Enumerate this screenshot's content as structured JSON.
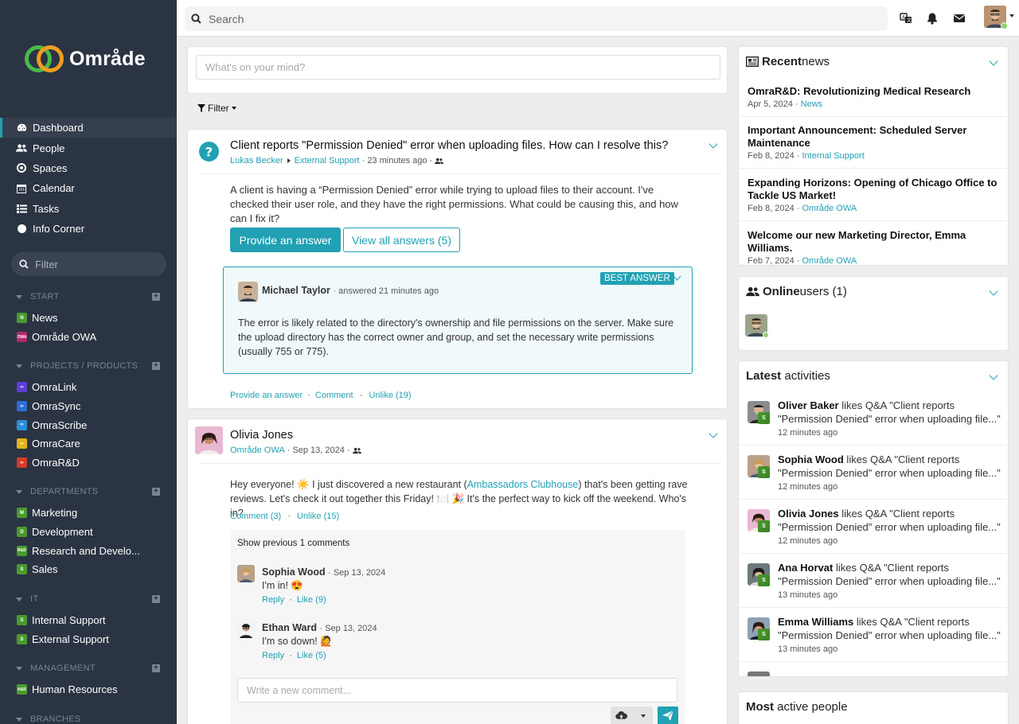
{
  "brand": {
    "name": "Område"
  },
  "nav": [
    {
      "label": "Dashboard",
      "icon": "dashboard-icon",
      "active": true
    },
    {
      "label": "People",
      "icon": "people-icon"
    },
    {
      "label": "Spaces",
      "icon": "spaces-icon"
    },
    {
      "label": "Calendar",
      "icon": "calendar-icon"
    },
    {
      "label": "Tasks",
      "icon": "tasks-icon"
    },
    {
      "label": "Info Corner",
      "icon": "info-corner-icon"
    }
  ],
  "sidebar_filter": {
    "placeholder": "Filter"
  },
  "sections": [
    {
      "title": "START",
      "items": [
        {
          "label": "News",
          "badge": "N",
          "color": "#4a9b2f"
        },
        {
          "label": "Område OWA",
          "badge": "OWA",
          "color": "#b0286a"
        }
      ]
    },
    {
      "title": "PROJECTS / PRODUCTS",
      "items": [
        {
          "label": "OmraLink",
          "badge": "",
          "color": "#5b3fd6"
        },
        {
          "label": "OmraSync",
          "badge": "",
          "color": "#2a6fd8"
        },
        {
          "label": "OmraScribe",
          "badge": "",
          "color": "#2a8fd8"
        },
        {
          "label": "OmraCare",
          "badge": "",
          "color": "#e0b41a"
        },
        {
          "label": "OmraR&D",
          "badge": "",
          "color": "#d63a2a"
        }
      ]
    },
    {
      "title": "DEPARTMENTS",
      "items": [
        {
          "label": "Marketing",
          "badge": "M",
          "color": "#4a9b2f"
        },
        {
          "label": "Development",
          "badge": "D",
          "color": "#4a9b2f"
        },
        {
          "label": "Research and Develo...",
          "badge": "R&D",
          "color": "#4a9b2f"
        },
        {
          "label": "Sales",
          "badge": "S",
          "color": "#4a9b2f"
        }
      ]
    },
    {
      "title": "IT",
      "items": [
        {
          "label": "Internal Support",
          "badge": "S",
          "color": "#4a9b2f"
        },
        {
          "label": "External Support",
          "badge": "S",
          "color": "#4a9b2f"
        }
      ]
    },
    {
      "title": "MANAGEMENT",
      "items": [
        {
          "label": "Human Resources",
          "badge": "H&R",
          "color": "#4a9b2f"
        }
      ]
    },
    {
      "title": "BRANCHES",
      "items": []
    }
  ],
  "topbar": {
    "search_placeholder": "Search"
  },
  "composer": {
    "placeholder": "What's on your mind?"
  },
  "feed_filter": {
    "label": "Filter"
  },
  "post1": {
    "title": "Client reports \"Permission Denied\" error when uploading files. How can I resolve this?",
    "author": "Lukas Becker",
    "space": "External Support",
    "time": "· 23 minutes ago ·",
    "body": "A client is having a “Permission Denied” error while trying to upload files to their account. I've checked their user role, and they have the right permissions. What could be causing this, and how can I fix it?",
    "btn_answer": "Provide an answer",
    "btn_view": "View all answers (5)",
    "best": {
      "badge": "BEST ANSWER",
      "author": "Michael Taylor",
      "time": "· answered 21 minutes ago",
      "body": "The error is likely related to the directory's ownership and file permissions on the server. Make sure the upload directory has the correct owner and group, and set the necessary write permissions (usually 755 or 775)."
    },
    "actions": {
      "answer": "Provide an answer",
      "dot": "·",
      "comment": "Comment",
      "unlike": "Unlike (19)"
    }
  },
  "post2": {
    "author": "Olivia Jones",
    "space": "Område OWA",
    "time": "· Sep 13, 2024 ·",
    "body_pre": "Hey everyone! ☀️ I just discovered a new restaurant (",
    "body_link": "Ambassadors Clubhouse",
    "body_post": ") that's been getting rave reviews. Let's check it out together this Friday! 🍽️ 🎉 It's the perfect way to kick off the weekend. Who's in?",
    "actions": {
      "comment": "Comment (3)",
      "dot": "·",
      "unlike": "Unlike (15)"
    },
    "show_prev": "Show previous 1 comments",
    "comments": [
      {
        "author": "Sophia Wood",
        "date": "· Sep 13, 2024",
        "text": "I'm in! 😍",
        "reply": "Reply",
        "dot": "·",
        "like": "Like (9)"
      },
      {
        "author": "Ethan Ward",
        "date": "· Sep 13, 2024",
        "text": "I'm so down! 🙋",
        "reply": "Reply",
        "dot": "·",
        "like": "Like (5)"
      }
    ],
    "new_comment_placeholder": "Write a new comment..."
  },
  "recent_news": {
    "title_bold": "Recent",
    "title_rest": " news",
    "items": [
      {
        "title": "OmraR&D: Revolutionizing Medical Research",
        "date": "Apr 5, 2024 ·",
        "space": "News"
      },
      {
        "title": "Important Announcement: Scheduled Server Maintenance",
        "date": "Feb 8, 2024 ·",
        "space": "Internal Support"
      },
      {
        "title": "Expanding Horizons: Opening of Chicago Office to Tackle US Market!",
        "date": "Feb 8, 2024 ·",
        "space": "Område OWA"
      },
      {
        "title": "Welcome our new Marketing Director, Emma Williams.",
        "date": "Feb 7, 2024 ·",
        "space": "Område OWA"
      }
    ]
  },
  "online_users": {
    "title_bold": "Online",
    "title_rest": " users (1)"
  },
  "latest_activities": {
    "title_bold": "Latest",
    "title_rest": " activities",
    "items": [
      {
        "name": "Oliver Baker",
        "text": " likes Q&A \"Client reports \"Permission Denied\" error when uploading file...\"",
        "time": "12 minutes ago"
      },
      {
        "name": "Sophia Wood",
        "text": " likes Q&A \"Client reports \"Permission Denied\" error when uploading file...\"",
        "time": "12 minutes ago"
      },
      {
        "name": "Olivia Jones",
        "text": " likes Q&A \"Client reports \"Permission Denied\" error when uploading file...\"",
        "time": "12 minutes ago"
      },
      {
        "name": "Ana Horvat",
        "text": " likes Q&A \"Client reports \"Permission Denied\" error when uploading file...\"",
        "time": "13 minutes ago"
      },
      {
        "name": "Emma Williams",
        "text": " likes Q&A \"Client reports \"Permission Denied\" error when uploading file...\"",
        "time": "13 minutes ago"
      }
    ]
  },
  "most_active": {
    "title_bold": "Most",
    "title_rest": " active people"
  },
  "colors": {
    "accent": "#21a1b3",
    "sidebar": "#2b3443",
    "online": "#8fd16a"
  }
}
